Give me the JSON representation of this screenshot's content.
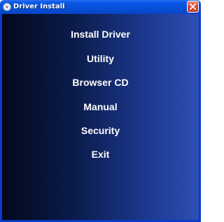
{
  "window": {
    "title": "Driver Install"
  },
  "menu": {
    "items": [
      {
        "label": "Install Driver"
      },
      {
        "label": "Utility"
      },
      {
        "label": "Browser CD"
      },
      {
        "label": "Manual"
      },
      {
        "label": "Security"
      },
      {
        "label": "Exit"
      }
    ]
  },
  "icons": {
    "app": "disc-icon",
    "close": "close-icon"
  },
  "colors": {
    "titlebar": "#0650d8",
    "close_button": "#d8503a",
    "background_dark": "#02081c",
    "background_light": "#2e4fb6",
    "text": "#ffffff"
  }
}
